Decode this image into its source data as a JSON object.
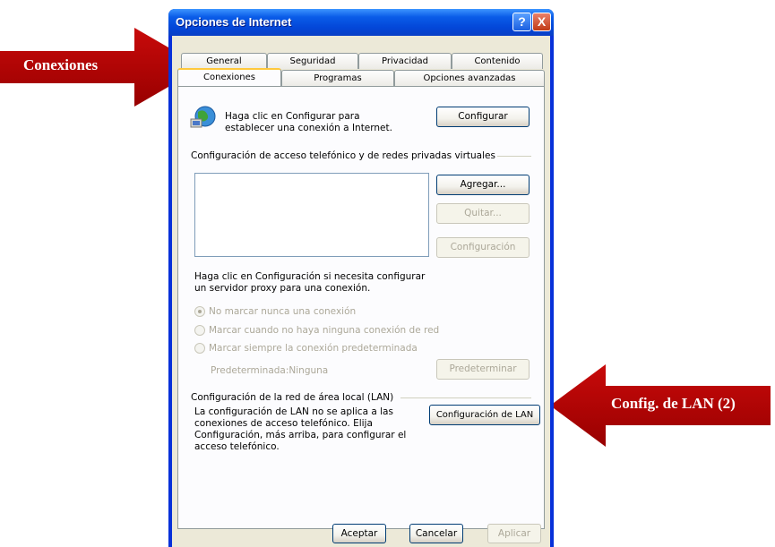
{
  "window": {
    "title": "Opciones de Internet",
    "help_label": "?",
    "close_label": "X"
  },
  "tabs_row1": [
    "General",
    "Seguridad",
    "Privacidad",
    "Contenido"
  ],
  "tabs_row2": [
    "Conexiones",
    "Programas",
    "Opciones avanzadas"
  ],
  "active_tab": "Conexiones",
  "setup": {
    "text_line1": "Haga clic en Configurar para",
    "text_line2": "establecer una conexión a Internet.",
    "button": "Configurar"
  },
  "dialup": {
    "section_title": "Configuración de acceso telefónico y de redes privadas virtuales",
    "add_button": "Agregar...",
    "remove_button": "Quitar...",
    "settings_button": "Configuración",
    "proxy_line1": "Haga clic en Configuración si necesita configurar",
    "proxy_line2": "un servidor proxy para una conexión.",
    "options": [
      "No marcar nunca una conexión",
      "Marcar cuando no haya ninguna conexión de red",
      "Marcar siempre la conexión predeterminada"
    ],
    "default_label": "Predeterminada:Ninguna",
    "default_button": "Predeterminar"
  },
  "lan": {
    "section_title": "Configuración de la red de área local (LAN)",
    "text_line1": "La configuración de LAN no se aplica a las",
    "text_line2": "conexiones de acceso telefónico. Elija",
    "text_line3": "Configuración, más arriba, para configurar el",
    "text_line4": "acceso telefónico.",
    "button": "Configuración de LAN"
  },
  "footer": {
    "ok": "Aceptar",
    "cancel": "Cancelar",
    "apply": "Aplicar"
  },
  "callouts": {
    "left": "Conexiones",
    "right": "Config. de LAN (2)",
    "color": "#b00000"
  }
}
